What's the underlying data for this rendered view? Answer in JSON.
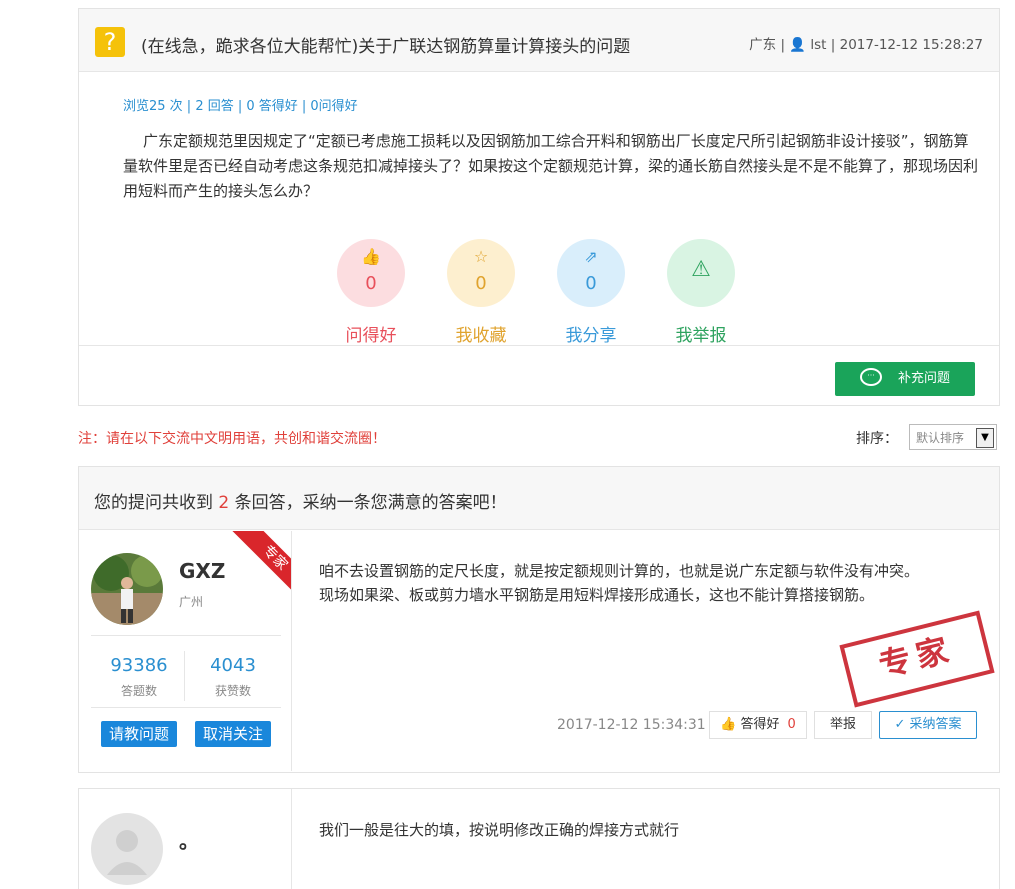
{
  "question": {
    "icon": "question-mark-icon",
    "icon_glyph": "?",
    "title": "(在线急，跪求各位大能帮忙)关于广联达钢筋算量计算接头的问题",
    "meta": "广东 | 👤 lst | 2017-12-12 15:28:27",
    "stats": "浏览25 次 | 2 回答 | 0 答得好 | 0问得好",
    "body": "广东定额规范里因规定了“定额已考虑施工损耗以及因钢筋加工综合开料和钢筋出厂长度定尺所引起钢筋非设计接驳”，钢筋算量软件里是否已经自动考虑这条规范扣减掉接头了？如果按这个定额规范计算，梁的通长筋自然接头是不是不能算了，那现场因利用短料而产生的接头怎么办？",
    "actions": [
      {
        "label": "问得好",
        "count": "0",
        "icon": "thumbs-up-icon",
        "glyph": "👍",
        "color": "#e8505b",
        "bg": "#fcdde0"
      },
      {
        "label": "我收藏",
        "count": "0",
        "icon": "star-icon",
        "glyph": "☆",
        "color": "#e0a32e",
        "bg": "#fdefcf"
      },
      {
        "label": "我分享",
        "count": "0",
        "icon": "share-icon",
        "glyph": "⇗",
        "color": "#3a9ad9",
        "bg": "#d9eefb"
      },
      {
        "label": "我举报",
        "count": "",
        "icon": "warning-icon",
        "glyph": "⚠",
        "color": "#2ea35f",
        "bg": "#d9f4e3"
      }
    ],
    "supplement_label": "补充问题"
  },
  "notice": "注：请在以下交流中文明用语，共创和谐交流圈！",
  "sort": {
    "label": "排序：",
    "selected": "默认排序",
    "arrow": "▼"
  },
  "answers_header": {
    "prefix": "您的提问共收到",
    "count": "2",
    "suffix": "条回答，采纳一条您满意的答案吧！"
  },
  "answers": [
    {
      "name": "GXZ",
      "location": "广州",
      "ribbon": "专家",
      "answers_count": "93386",
      "answers_label": "答题数",
      "likes_count": "4043",
      "likes_label": "获赞数",
      "ask_label": "请教问题",
      "unfollow_label": "取消关注",
      "text": "咱不去设置钢筋的定尺长度，就是按定额规则计算的，也就是说广东定额与软件没有冲突。现场如果梁、板或剪力墙水平钢筋是用短料焊接形成通长，这也不能计算搭接钢筋。",
      "stamp": "专家",
      "time": "2017-12-12 15:34:31",
      "like_label": "答得好",
      "like_count": "0",
      "report_label": "举报",
      "accept_label": "采纳答案"
    },
    {
      "name": "。",
      "text": "我们一般是往大的填，按说明修改正确的焊接方式就行"
    }
  ],
  "colors": {
    "accent_green": "#1aa45a",
    "link_blue": "#2a8fd0",
    "alert_red": "#e0413b",
    "question_yellow": "#f5c20a"
  }
}
